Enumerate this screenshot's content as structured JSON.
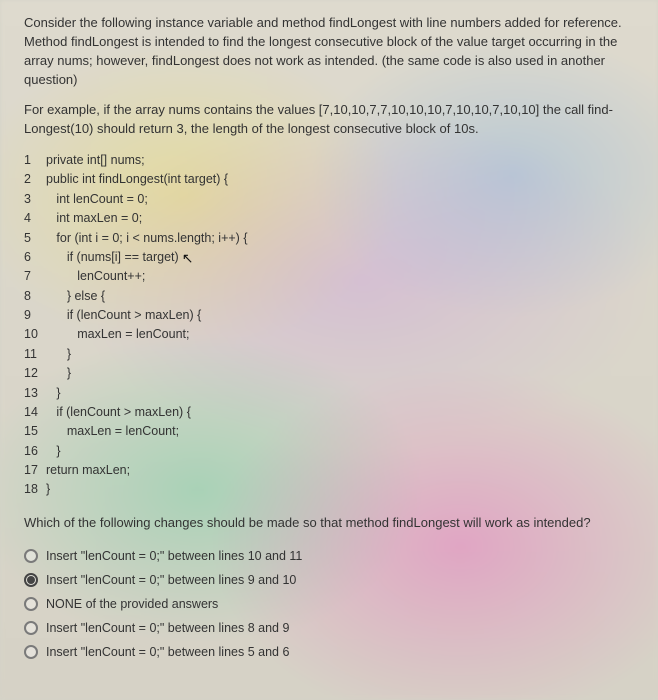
{
  "intro": {
    "p1": "Consider the following instance variable and method findLongest with line numbers added for reference. Method findLongest is intended to find the longest consecutive block of the value target occurring in the array nums; however, findLongest does not work as intended. (the same code is also used in another question)",
    "p2": "For example, if the array nums contains the values [7,10,10,7,7,10,10,10,7,10,10,7,10,10] the call find-Longest(10) should return 3, the length of the longest consecutive block of 10s."
  },
  "code": {
    "lines": [
      {
        "n": "1",
        "t": "private int[] nums;"
      },
      {
        "n": "2",
        "t": "public int findLongest(int target) {"
      },
      {
        "n": "3",
        "t": "   int lenCount = 0;"
      },
      {
        "n": "4",
        "t": "   int maxLen = 0;"
      },
      {
        "n": "5",
        "t": "   for (int i = 0; i < nums.length; i++) {"
      },
      {
        "n": "6",
        "t": "      if (nums[i] == target)",
        "cursor": true
      },
      {
        "n": "7",
        "t": "         lenCount++;"
      },
      {
        "n": "8",
        "t": "      } else {"
      },
      {
        "n": "9",
        "t": "      if (lenCount > maxLen) {"
      },
      {
        "n": "10",
        "t": "         maxLen = lenCount;"
      },
      {
        "n": "11",
        "t": "      }"
      },
      {
        "n": "12",
        "t": "      }"
      },
      {
        "n": "13",
        "t": "   }"
      },
      {
        "n": "14",
        "t": "   if (lenCount > maxLen) {"
      },
      {
        "n": "15",
        "t": "      maxLen = lenCount;"
      },
      {
        "n": "16",
        "t": "   }"
      },
      {
        "n": "17",
        "t": "return maxLen;"
      },
      {
        "n": "18",
        "t": "}"
      }
    ]
  },
  "question": "Which of the following changes should be made so that method findLongest will work as intended?",
  "options": [
    {
      "label": "Insert \"lenCount = 0;\" between lines 10 and 11",
      "selected": false
    },
    {
      "label": "Insert \"lenCount = 0;\" between lines 9 and 10",
      "selected": true
    },
    {
      "label": "NONE of the provided answers",
      "selected": false
    },
    {
      "label": "Insert \"lenCount = 0;\" between lines 8 and 9",
      "selected": false
    },
    {
      "label": "Insert \"lenCount = 0;\" between lines 5 and 6",
      "selected": false
    }
  ]
}
